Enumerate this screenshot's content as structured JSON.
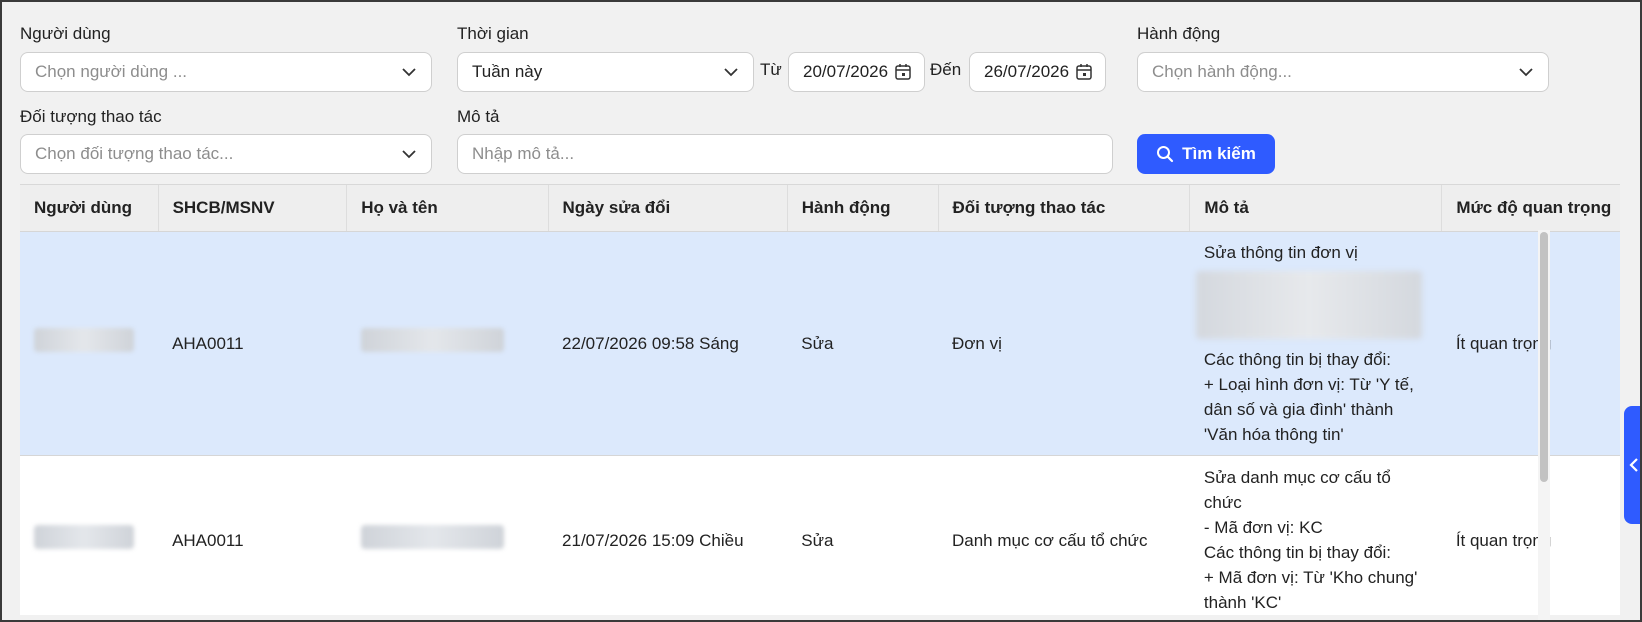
{
  "filters": {
    "user": {
      "label": "Người dùng",
      "placeholder": "Chọn người dùng ..."
    },
    "time": {
      "label": "Thời gian",
      "value": "Tuần này",
      "from_label": "Từ",
      "from_date": "20/07/2026",
      "to_label": "Đến",
      "to_date": "26/07/2026"
    },
    "action": {
      "label": "Hành động",
      "placeholder": "Chọn hành động..."
    },
    "object": {
      "label": "Đối tượng thao tác",
      "placeholder": "Chọn đối tượng thao tác..."
    },
    "desc": {
      "label": "Mô tả",
      "placeholder": "Nhập mô tả..."
    },
    "search_button": "Tìm kiếm"
  },
  "table": {
    "columns": [
      "Người dùng",
      "SHCB/MSNV",
      "Họ và tên",
      "Ngày sửa đổi",
      "Hành động",
      "Đối tượng thao tác",
      "Mô tả",
      "Mức độ quan trọng"
    ],
    "rows": [
      {
        "code": "AHA0011",
        "date": "22/07/2026 09:58 Sáng",
        "action": "Sửa",
        "object": "Đơn vị",
        "desc_line1": "Sửa thông tin đơn vị",
        "desc_changes": "Các thông tin bị thay đổi:",
        "desc_change1": "+ Loại hình đơn vị: Từ 'Y tế, dân số và gia đình' thành 'Văn hóa thông tin'",
        "importance": "Ít quan trọng"
      },
      {
        "code": "AHA0011",
        "date": "21/07/2026 15:09 Chiều",
        "action": "Sửa",
        "object": "Danh mục cơ cấu tổ chức",
        "desc_line1": "Sửa danh mục cơ cấu tổ chức",
        "desc_line2": "- Mã đơn vị: KC",
        "desc_changes": "Các thông tin bị thay đổi:",
        "desc_change1": "+ Mã đơn vị: Từ 'Kho chung' thành 'KC'",
        "importance": "Ít quan trọng"
      }
    ]
  },
  "colors": {
    "accent": "#2f5bff",
    "selected_row": "#dce9fc",
    "header_bg": "#eeeeee"
  },
  "icons": {
    "dropdown": "chevron-down-icon",
    "date": "calendar-icon",
    "search": "search-icon",
    "side_toggle": "chevron-left-icon"
  }
}
